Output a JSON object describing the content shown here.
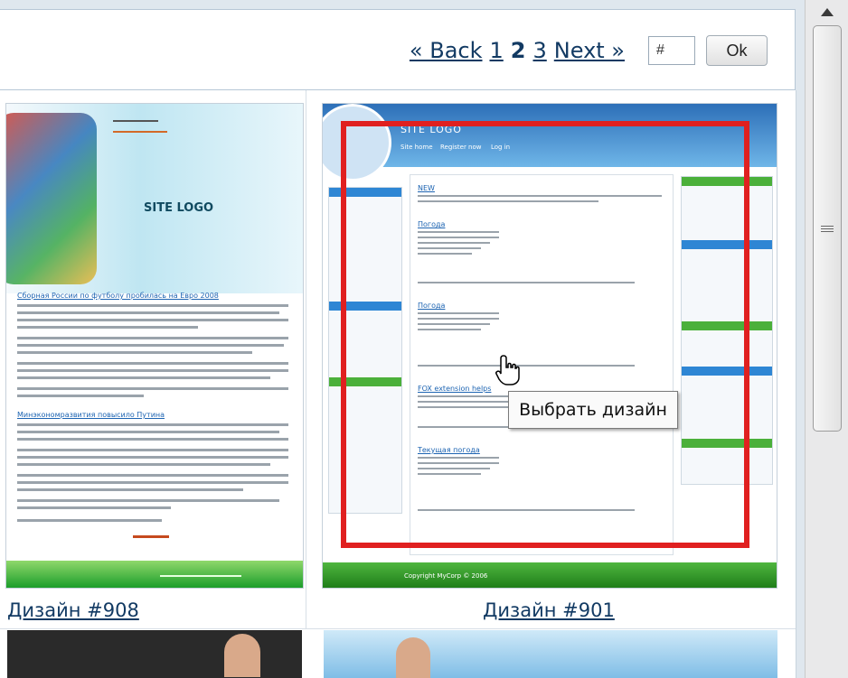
{
  "pager": {
    "back_label": "« Back",
    "page1": "1",
    "page2": "2",
    "page3": "3",
    "next_label": "Next »",
    "page_input_value": "#",
    "ok_label": "Ok"
  },
  "designs": [
    {
      "caption": "Дизайн #908"
    },
    {
      "caption": "Дизайн #901"
    }
  ],
  "tooltip": "Выбрать дизайн",
  "thumb_left": {
    "site_logo": "SITE LOGO",
    "news_title_1": "Сборная России по футболу пробилась на Евро 2008",
    "news_title_2": "Минэкономразвития повысило Путина"
  },
  "thumb_right": {
    "site_logo": "SITE LOGO",
    "nav": [
      "Site home",
      "Register now",
      "Log in"
    ],
    "news_title_1": "NEW",
    "news_title_2": "Погода",
    "news_title_3": "Погода",
    "news_title_4": "FOX extension helps",
    "news_title_5": "Текущая погода",
    "footer": "Copyright MyCorp © 2006"
  },
  "colors": {
    "link": "#123a63",
    "selection_frame": "#e02020",
    "header_blue": "#2d6fb8",
    "footer_green": "#1b9d2b"
  },
  "icons": [
    "hand-cursor-icon",
    "scroll-up-arrow-icon",
    "scroll-grip-icon"
  ]
}
